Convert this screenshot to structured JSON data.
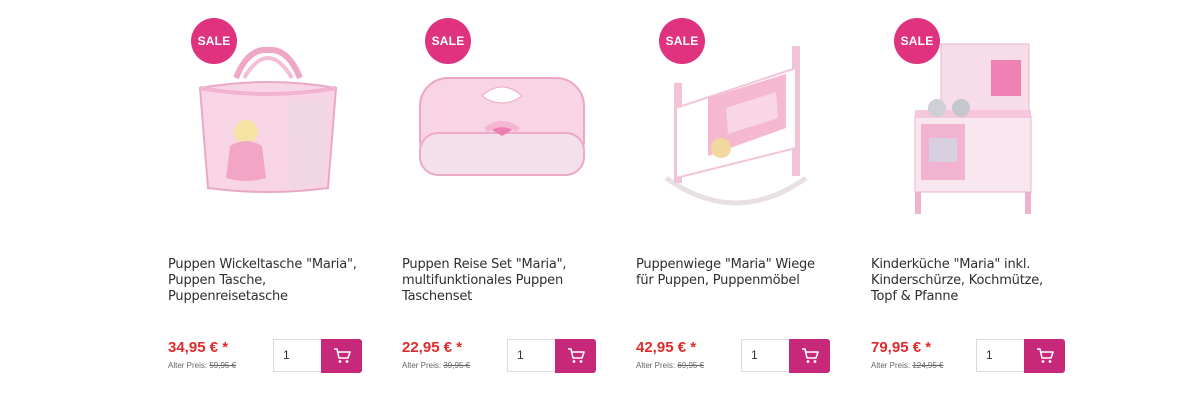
{
  "products": [
    {
      "badge": "SALE",
      "title": "Puppen Wickeltasche \"Maria\", Puppen Tasche, Puppenreisetasche",
      "price": "34,95 € *",
      "old_label": "Alter Preis:",
      "old_price": "59,95 €",
      "qty": "1"
    },
    {
      "badge": "SALE",
      "title": "Puppen Reise Set \"Maria\", multifunktionales Puppen Taschenset",
      "price": "22,95 € *",
      "old_label": "Alter Preis:",
      "old_price": "39,95 €",
      "qty": "1"
    },
    {
      "badge": "SALE",
      "title": "Puppenwiege \"Maria\" Wiege für Puppen, Puppenmöbel",
      "price": "42,95 € *",
      "old_label": "Alter Preis:",
      "old_price": "69,95 €",
      "qty": "1"
    },
    {
      "badge": "SALE",
      "title": "Kinderküche \"Maria\" inkl. Kinderschürze, Kochmütze, Topf & Pfanne",
      "price": "79,95 € *",
      "old_label": "Alter Preis:",
      "old_price": "124,95 €",
      "qty": "1"
    }
  ],
  "colors": {
    "badge": "#e0337f",
    "cart_button": "#c8287a",
    "price": "#e02b2b"
  },
  "icons": {
    "cart": "shopping-cart-icon"
  }
}
